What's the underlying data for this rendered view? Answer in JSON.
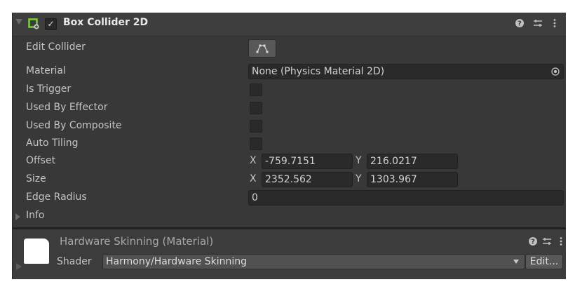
{
  "component": {
    "title": "Box Collider 2D",
    "enabled_glyph": "✓",
    "icons": {
      "help": "?",
      "presets": "⇄",
      "menu": "⋮"
    },
    "accent_color": "#7ad33b"
  },
  "fields": {
    "edit_collider_label": "Edit Collider",
    "material_label": "Material",
    "material_value": "None (Physics Material 2D)",
    "is_trigger_label": "Is Trigger",
    "used_by_effector_label": "Used By Effector",
    "used_by_composite_label": "Used By Composite",
    "auto_tiling_label": "Auto Tiling",
    "offset_label": "Offset",
    "offset_x": "-759.7151",
    "offset_y": "216.0217",
    "size_label": "Size",
    "size_x": "2352.562",
    "size_y": "1303.967",
    "edge_radius_label": "Edge Radius",
    "edge_radius_value": "0",
    "info_label": "Info",
    "x_axis": "X",
    "y_axis": "Y"
  },
  "material_section": {
    "title": "Hardware Skinning (Material)",
    "shader_label": "Shader",
    "shader_value": "Harmony/Hardware Skinning",
    "edit_label": "Edit..."
  }
}
